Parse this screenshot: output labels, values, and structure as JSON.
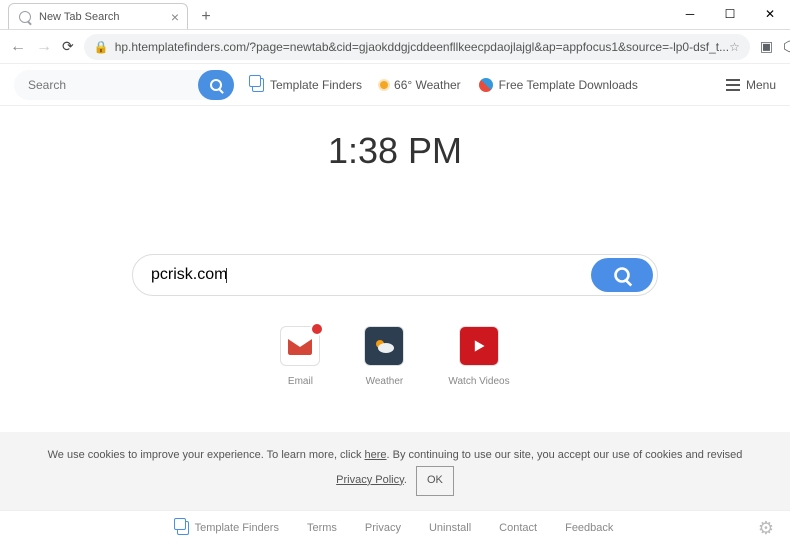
{
  "window": {
    "tab_title": "New Tab Search"
  },
  "address": {
    "url": "hp.htemplatefinders.com/?page=newtab&cid=gjaokddgjcddeenfllkeecpdaojlajgl&ap=appfocus1&source=-lp0-dsf_t..."
  },
  "toolbar": {
    "search_placeholder": "Search",
    "template_finders": "Template Finders",
    "weather": "66° Weather",
    "downloads": "Free Template Downloads",
    "menu": "Menu"
  },
  "main": {
    "clock": "1:38 PM",
    "search_value": "pcrisk.com",
    "tiles": [
      {
        "label": "Email"
      },
      {
        "label": "Weather"
      },
      {
        "label": "Watch Videos"
      }
    ]
  },
  "cookie": {
    "part1": "We use cookies to improve your experience. To learn more, click ",
    "here": "here",
    "part2": ". By continuing to use our site, you accept our use of cookies and revised ",
    "privacy": "Privacy Policy",
    "dot": ". ",
    "ok": "OK"
  },
  "footer": {
    "items": [
      "Template Finders",
      "Terms",
      "Privacy",
      "Uninstall",
      "Contact",
      "Feedback"
    ]
  }
}
